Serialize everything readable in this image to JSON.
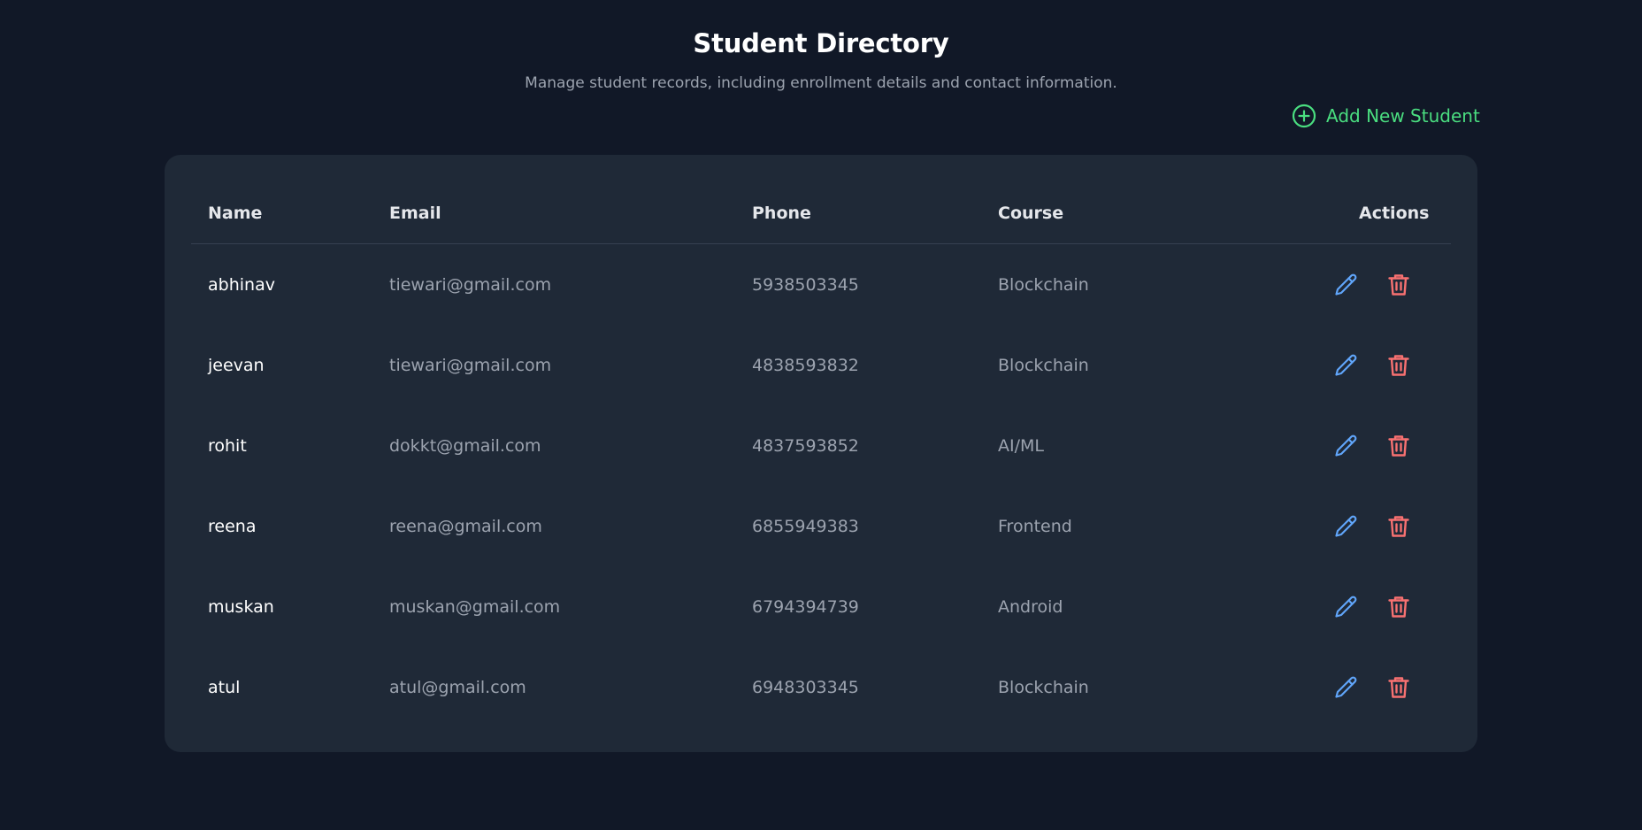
{
  "header": {
    "title": "Student Directory",
    "subtitle": "Manage student records, including enrollment details and contact information."
  },
  "toolbar": {
    "add_label": "Add New Student",
    "add_icon": "plus-circle-icon",
    "accent_color": "#4ade80"
  },
  "table": {
    "columns": [
      "Name",
      "Email",
      "Phone",
      "Course",
      "Actions"
    ],
    "rows": [
      {
        "name": "abhinav",
        "email": "tiewari@gmail.com",
        "phone": "5938503345",
        "course": "Blockchain"
      },
      {
        "name": "jeevan",
        "email": "tiewari@gmail.com",
        "phone": "4838593832",
        "course": "Blockchain"
      },
      {
        "name": "rohit",
        "email": "dokkt@gmail.com",
        "phone": "4837593852",
        "course": "AI/ML"
      },
      {
        "name": "reena",
        "email": "reena@gmail.com",
        "phone": "6855949383",
        "course": "Frontend"
      },
      {
        "name": "muskan",
        "email": "muskan@gmail.com",
        "phone": "6794394739",
        "course": "Android"
      },
      {
        "name": "atul",
        "email": "atul@gmail.com",
        "phone": "6948303345",
        "course": "Blockchain"
      }
    ],
    "row_actions": {
      "edit_icon": "pencil-icon",
      "delete_icon": "trash-icon",
      "edit_color": "#60a5fa",
      "delete_color": "#f87171"
    }
  },
  "theme": {
    "background": "#111827",
    "card": "#1f2937"
  }
}
